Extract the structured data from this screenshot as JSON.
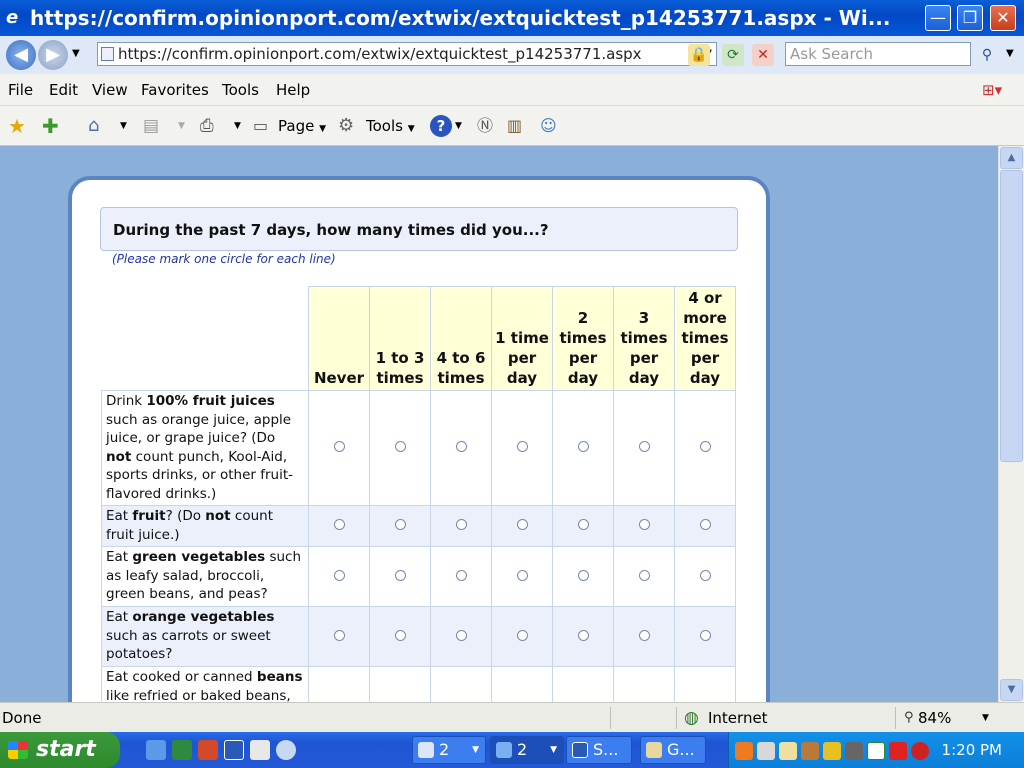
{
  "window": {
    "title": "https://confirm.opinionport.com/extwix/extquicktest_p14253771.aspx - Wi...",
    "minimize_glyph": "—",
    "restore_glyph": "❐",
    "close_glyph": "✕"
  },
  "address": {
    "url": "https://confirm.opinionport.com/extwix/extquicktest_p14253771.aspx",
    "search_placeholder": "Ask Search"
  },
  "menu": {
    "file": "File",
    "edit": "Edit",
    "view": "View",
    "favorites": "Favorites",
    "tools": "Tools",
    "help": "Help"
  },
  "commandbar": {
    "page": "Page",
    "tools": "Tools"
  },
  "survey": {
    "question": "During the past 7 days, how many times did you...?",
    "instruction": "(Please mark one circle for each line)",
    "columns": [
      "Never",
      "1 to 3 times",
      "4 to 6 times",
      "1 time per day",
      "2 times per day",
      "3 times per day",
      "4 or more times per day"
    ],
    "rows": [
      {
        "pre": "Drink ",
        "bold": "100% fruit juices",
        "post": " such as orange juice, apple juice, or grape juice? (Do ",
        "bold2": "not",
        "post2": " count punch, Kool-Aid, sports drinks, or other fruit-flavored drinks.)"
      },
      {
        "pre": "Eat ",
        "bold": "fruit",
        "post": "? (Do ",
        "bold2": "not",
        "post2": " count fruit juice.)"
      },
      {
        "pre": "Eat ",
        "bold": "green vegetables",
        "post": " such as leafy salad, broccoli, green beans, and peas?",
        "bold2": "",
        "post2": ""
      },
      {
        "pre": "Eat ",
        "bold": "orange vegetables",
        "post": " such as carrots or sweet potatoes?",
        "bold2": "",
        "post2": ""
      },
      {
        "pre": "Eat cooked or canned ",
        "bold": "beans",
        "post": " like refried or baked beans,",
        "bold2": "",
        "post2": ""
      }
    ]
  },
  "status": {
    "text": "Done",
    "zone": "Internet",
    "zoom": "84%"
  },
  "taskbar": {
    "start": "start",
    "tasks": [
      "2",
      "2",
      "S...",
      "G..."
    ],
    "clock": "1:20 PM"
  },
  "colors": {
    "titlebar": "#0348c4",
    "page_background": "#8ab0d9",
    "panel_border": "#5c84c2",
    "header_fill": "#ffffd8",
    "alt_row": "#ebf0fb"
  }
}
